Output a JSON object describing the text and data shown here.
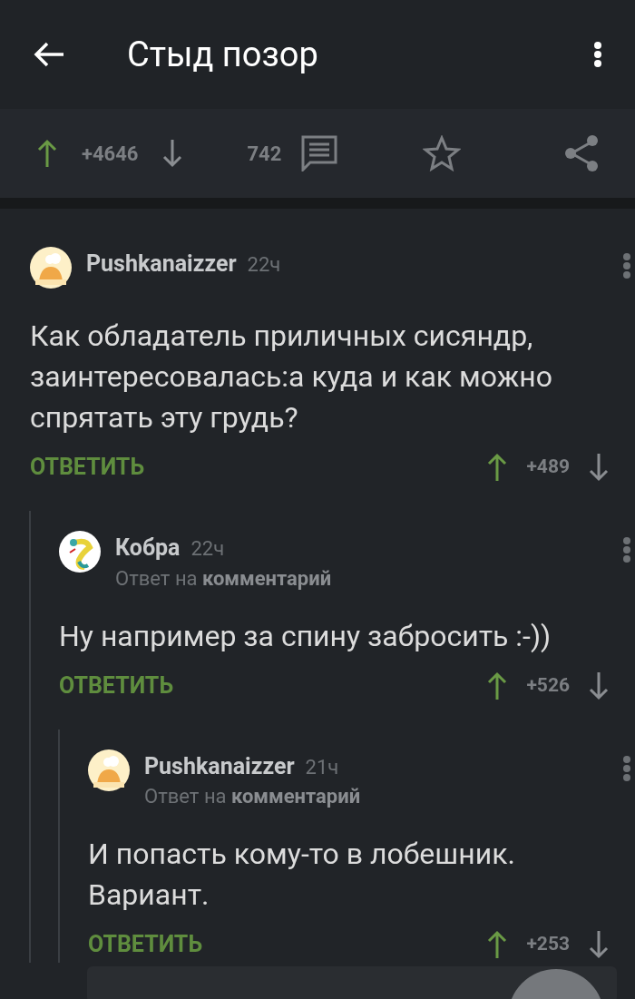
{
  "app_bar": {
    "title": "Стыд позор"
  },
  "post_toolbar": {
    "rating": "+4646",
    "comments_count": "742"
  },
  "comments": [
    {
      "author": "Pushkanaizzer",
      "time": "22ч",
      "avatar": {
        "kind": "chef"
      },
      "text": "Как обладатель приличных сисяндр, заинтересовалась:а куда и как можно спрятать эту грудь?",
      "reply_label": "ОТВЕТИТЬ",
      "rating": "+489",
      "children": [
        {
          "author": "Кобра",
          "time": "22ч",
          "avatar": {
            "kind": "snake"
          },
          "reply_to": "Ответ на **комментарий**",
          "text": "Ну например за спину забросить  :-))",
          "reply_label": "ОТВЕТИТЬ",
          "rating": "+526",
          "children": [
            {
              "author": "Pushkanaizzer",
              "time": "21ч",
              "avatar": {
                "kind": "chef"
              },
              "reply_to": "Ответ на **комментарий**",
              "text": "И попасть кому-то в лобешник. Вариант.",
              "reply_label": "ОТВЕТИТЬ",
              "rating": "+253"
            }
          ]
        }
      ]
    }
  ]
}
